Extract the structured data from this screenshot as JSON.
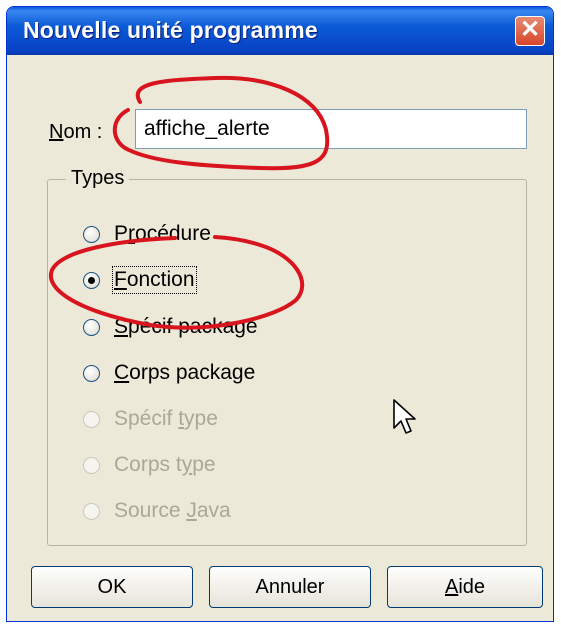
{
  "window": {
    "title": "Nouvelle unité programme"
  },
  "nom": {
    "label_prefix": "N",
    "label_rest": "om :",
    "value": "affiche_alerte"
  },
  "types": {
    "legend": "Types",
    "options": [
      {
        "pre": "P",
        "ul": "r",
        "post": "océdure",
        "checked": false,
        "enabled": true
      },
      {
        "pre": "",
        "ul": "F",
        "post": "onction",
        "checked": true,
        "enabled": true
      },
      {
        "pre": "",
        "ul": "S",
        "post": "pécif package",
        "checked": false,
        "enabled": true
      },
      {
        "pre": "",
        "ul": "C",
        "post": "orps package",
        "checked": false,
        "enabled": true
      },
      {
        "pre": "Spécif ",
        "ul": "t",
        "post": "ype",
        "checked": false,
        "enabled": false
      },
      {
        "pre": "Corps t",
        "ul": "y",
        "post": "pe",
        "checked": false,
        "enabled": false
      },
      {
        "pre": "Source ",
        "ul": "J",
        "post": "ava",
        "checked": false,
        "enabled": false
      }
    ]
  },
  "buttons": {
    "ok": "OK",
    "cancel": "Annuler",
    "help_ul": "A",
    "help_rest": "ide"
  },
  "colors": {
    "annotation": "#d8141e",
    "titlebar": "#0b5ad6",
    "dialog_bg": "#ece9d8"
  },
  "icons": {
    "close": "close-icon",
    "cursor": "mouse-pointer-icon"
  }
}
